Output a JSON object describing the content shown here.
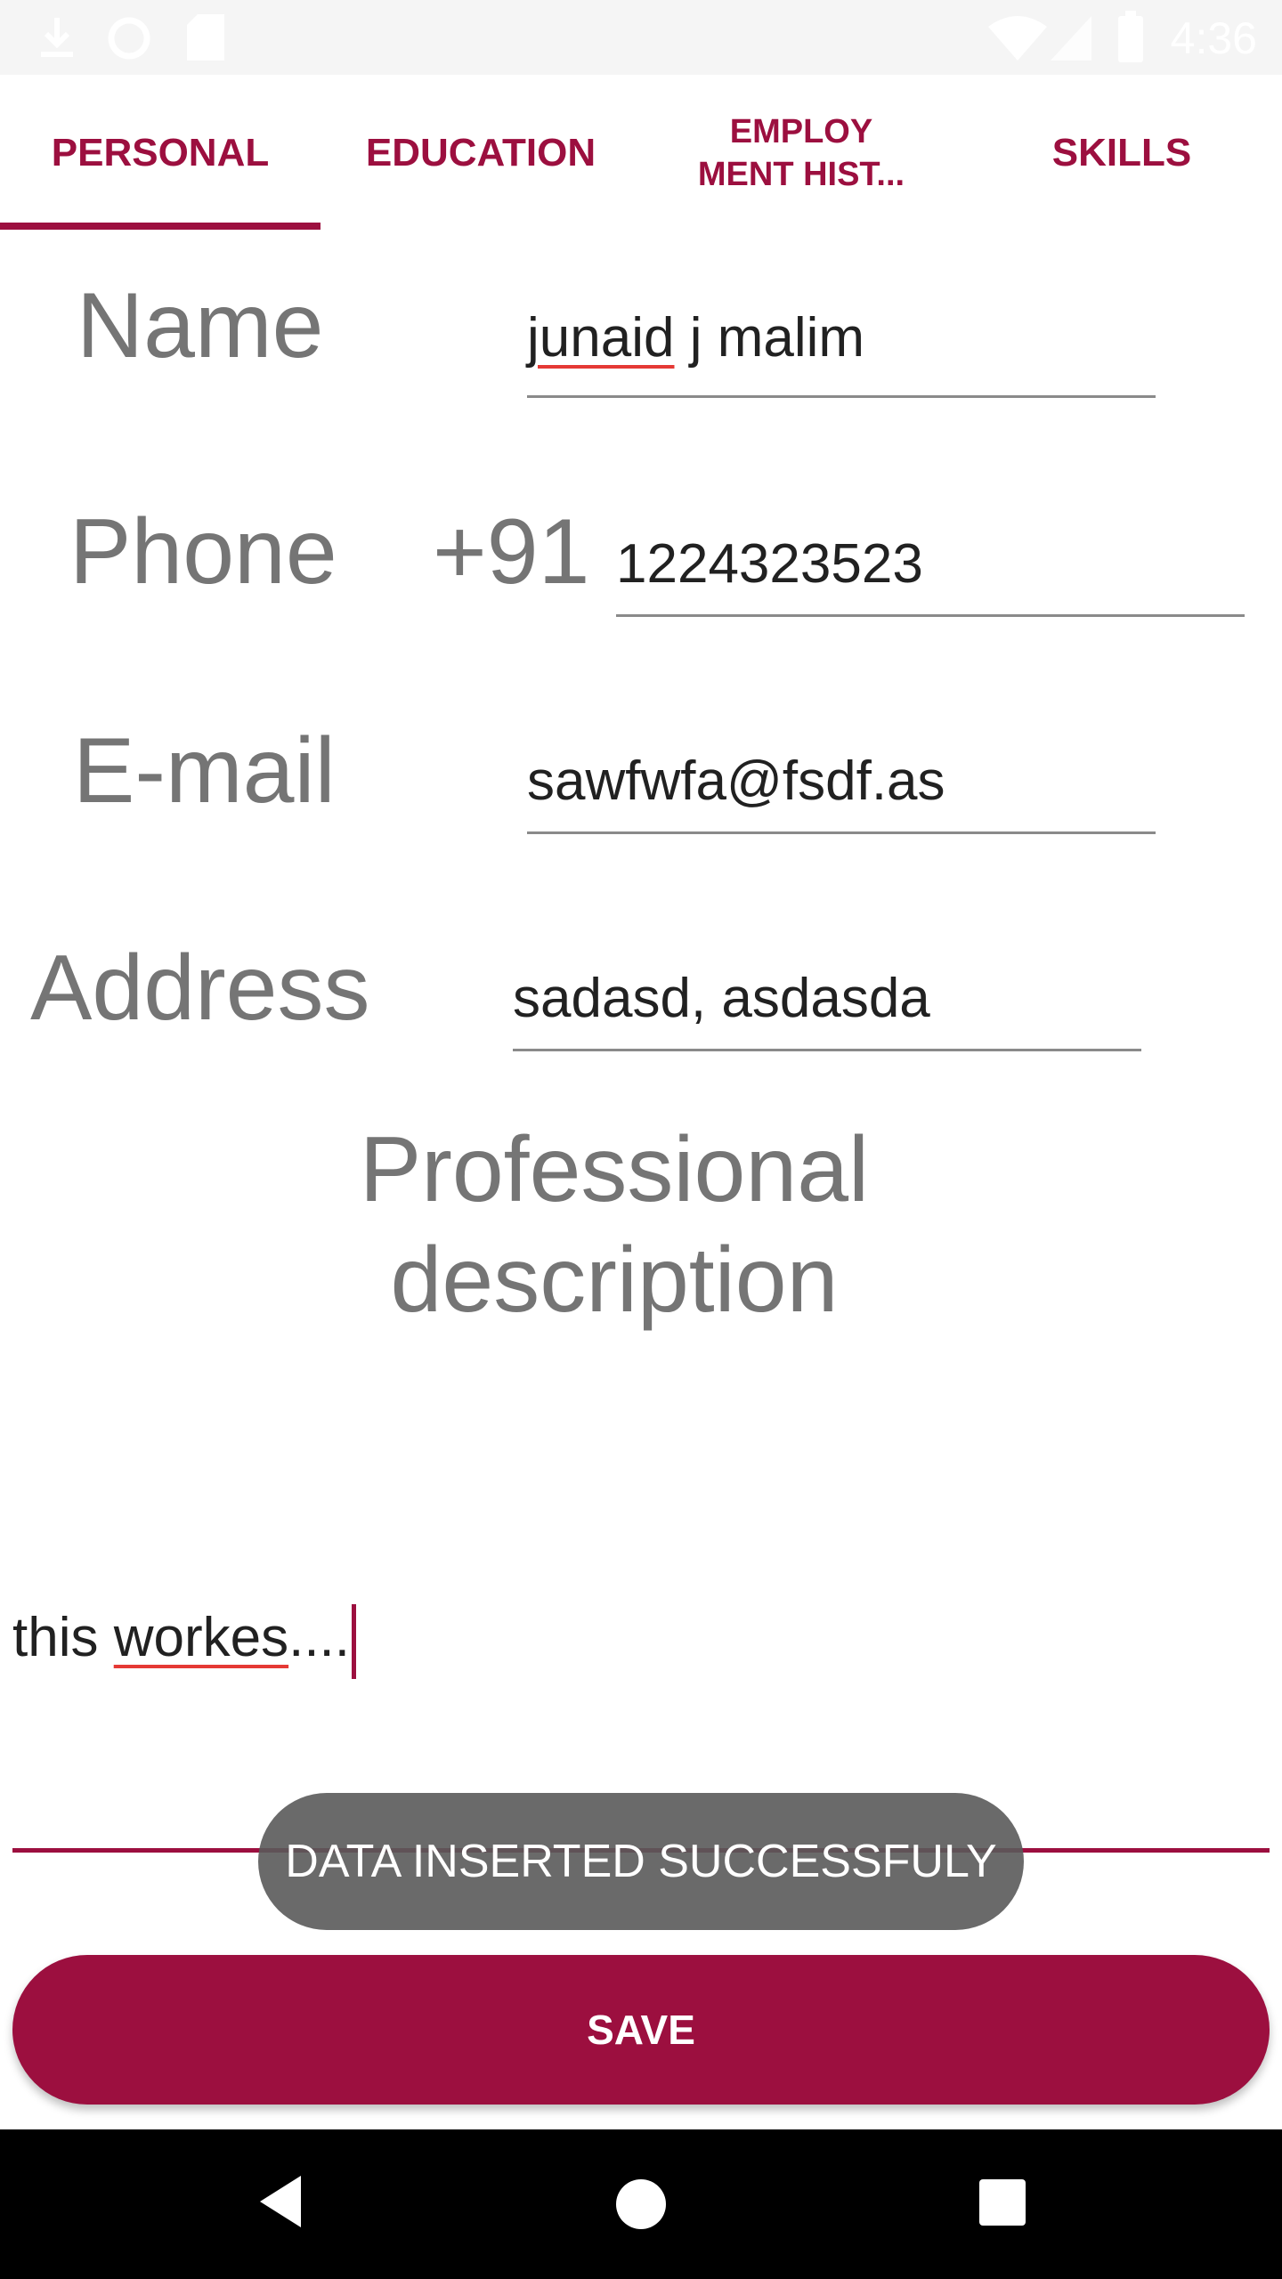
{
  "status_bar": {
    "time": "4:36",
    "icons": [
      "download-icon",
      "sync-icon",
      "sd-card-icon",
      "wifi-icon",
      "signal-icon",
      "battery-icon"
    ]
  },
  "tabs": [
    {
      "label": "PERSONAL",
      "selected": true
    },
    {
      "label": "EDUCATION",
      "selected": false
    },
    {
      "label_line1": "EMPLOY",
      "label_line2": "MENT HIST...",
      "selected": false
    },
    {
      "label": "SKILLS",
      "selected": false
    }
  ],
  "form": {
    "name": {
      "label": "Name",
      "value_word1": "junaid",
      "value_rest": " j malim"
    },
    "phone": {
      "label": "Phone",
      "prefix": "+91",
      "value": "1224323523"
    },
    "email": {
      "label": "E-mail",
      "value": "sawfwfa@fsdf.as"
    },
    "address": {
      "label": "Address",
      "value": "sadasd, asdasda"
    },
    "professional_description": {
      "label_line1": "Professional",
      "label_line2": "description",
      "value_word1": "this ",
      "value_word2": "workes",
      "value_rest": "...."
    }
  },
  "toast": {
    "message": "DATA INSERTED SUCCESSFULY"
  },
  "save_button": {
    "label": "SAVE"
  },
  "colors": {
    "accent": "#9c0f3f",
    "label_gray": "#757575",
    "toast_bg": "#5a5a5a",
    "spellcheck": "#e53935"
  },
  "nav_bar": {
    "icons": [
      "back-icon",
      "home-icon",
      "recents-icon"
    ]
  }
}
